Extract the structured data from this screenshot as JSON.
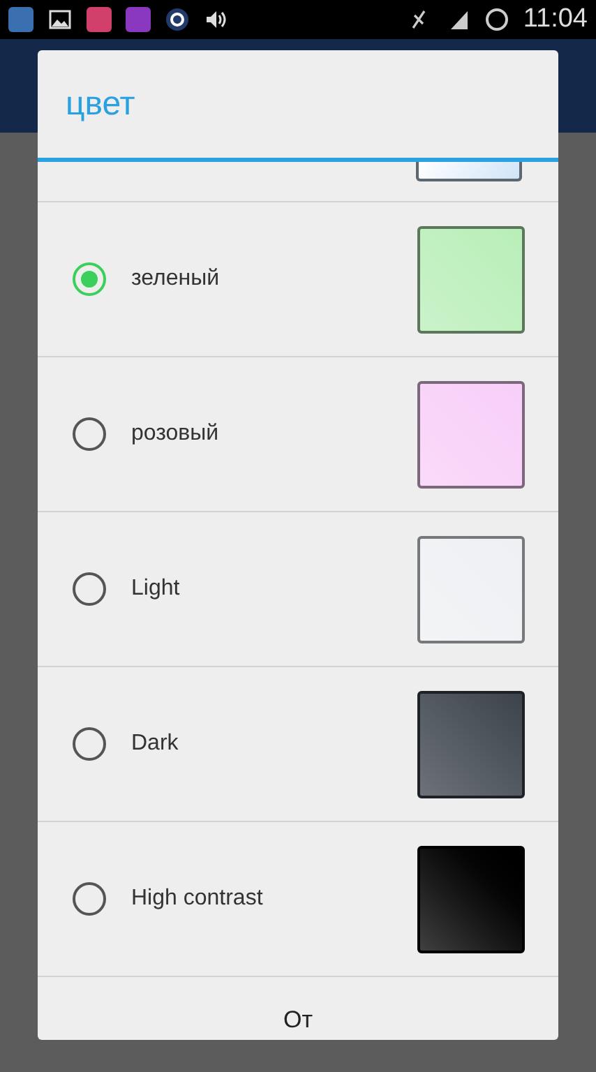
{
  "status_bar": {
    "time": "11:04"
  },
  "dialog": {
    "title": "цвет",
    "partial_swatch": {
      "color": "#cfe4f8"
    },
    "options": [
      {
        "label": "зеленый",
        "selected": true,
        "color": "#b8eeb8"
      },
      {
        "label": "розовый",
        "selected": false,
        "color": "#f8cef8"
      },
      {
        "label": "Light",
        "selected": false,
        "color": "#eef0f3"
      },
      {
        "label": "Dark",
        "selected": false,
        "color": "#3c434b"
      },
      {
        "label": "High contrast",
        "selected": false,
        "color": "#000000"
      }
    ],
    "button": "От"
  }
}
